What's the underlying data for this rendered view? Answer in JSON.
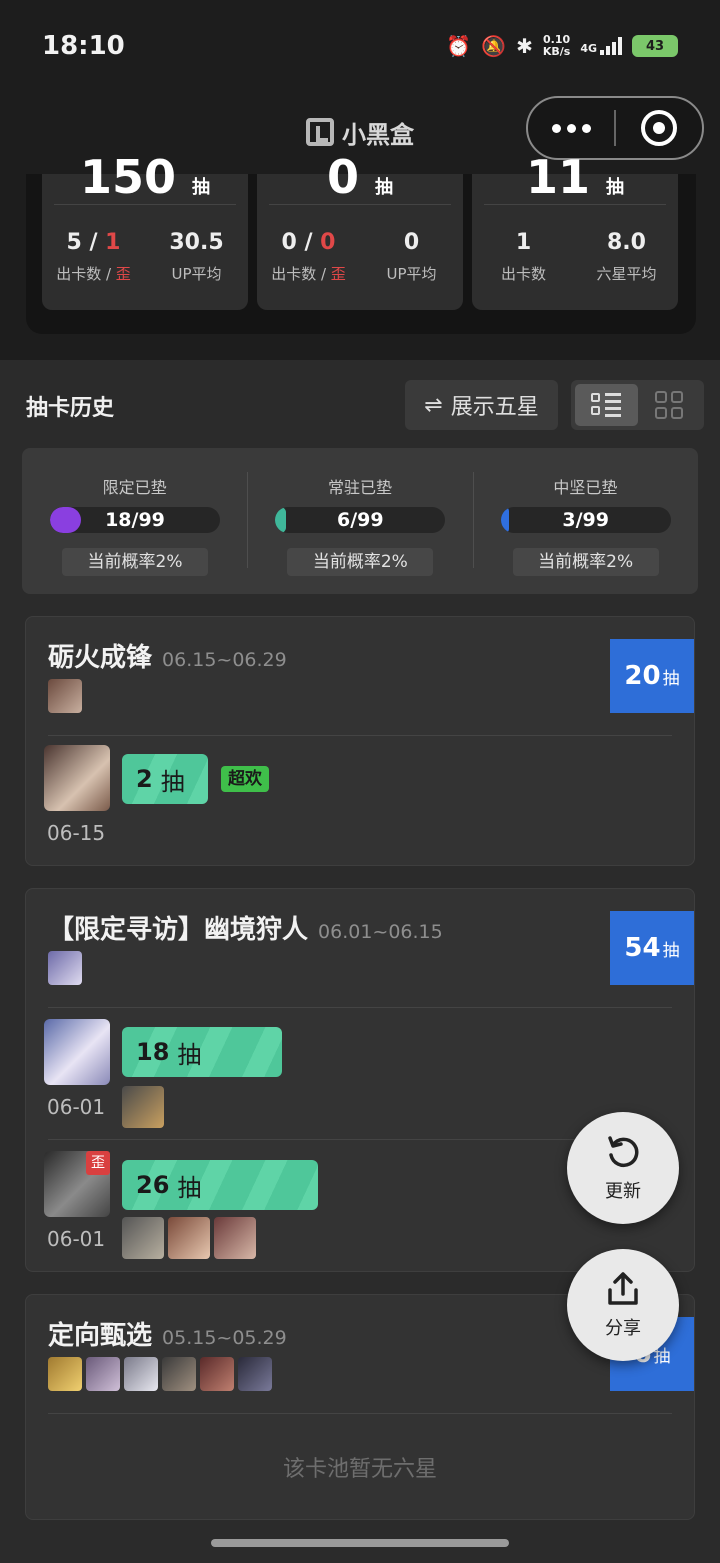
{
  "status_bar": {
    "time": "18:10",
    "net_speed_value": "0.10",
    "net_speed_unit": "KB/s",
    "network": "4G",
    "battery": "43"
  },
  "nav": {
    "title": "小黑盒",
    "more_icon": "more-dots-icon",
    "target_icon": "target-icon"
  },
  "stats": [
    {
      "big": "150",
      "big_unit": "抽",
      "left_value_a": "5",
      "left_sep": " / ",
      "left_value_b": "1",
      "left_label_a": "出卡数 / ",
      "left_label_b": "歪",
      "right_value": "30.5",
      "right_label": "UP平均"
    },
    {
      "big": "0",
      "big_unit": "抽",
      "left_value_a": "0",
      "left_sep": " / ",
      "left_value_b": "0",
      "left_label_a": "出卡数 / ",
      "left_label_b": "歪",
      "right_value": "0",
      "right_label": "UP平均"
    },
    {
      "big": "11",
      "big_unit": "抽",
      "left_value_a": "1",
      "left_sep": "",
      "left_value_b": "",
      "left_label_a": "出卡数",
      "left_label_b": "",
      "right_value": "8.0",
      "right_label": "六星平均"
    }
  ],
  "history": {
    "title": "抽卡历史",
    "filter_button": "展示五星",
    "filter_icon": "swap-arrows-icon",
    "view_list_icon": "list-view-icon",
    "view_grid_icon": "grid-view-icon"
  },
  "pity": [
    {
      "label": "限定已垫",
      "value": "18/99",
      "fraction": 0.18,
      "color": "#8a3fe0",
      "rate": "当前概率2%"
    },
    {
      "label": "常驻已垫",
      "value": "6/99",
      "fraction": 0.06,
      "color": "#3fb79a",
      "rate": "当前概率2%"
    },
    {
      "label": "中坚已垫",
      "value": "3/99",
      "fraction": 0.03,
      "color": "#2f6fe0",
      "rate": "当前概率2%"
    }
  ],
  "banners": [
    {
      "name": "砺火成锋",
      "dates": "06.15~06.29",
      "count": "20",
      "count_unit": "抽",
      "pulls": [
        {
          "date": "06-15",
          "count": "2",
          "unit": "抽",
          "badge": "超欢"
        }
      ]
    },
    {
      "name": "【限定寻访】幽境狩人",
      "dates": "06.01~06.15",
      "count": "54",
      "count_unit": "抽",
      "pulls": [
        {
          "date": "06-01",
          "count": "18",
          "unit": "抽"
        },
        {
          "date": "06-01",
          "count": "26",
          "unit": "抽",
          "off_badge": "歪"
        }
      ]
    },
    {
      "name": "定向甄选",
      "dates": "05.15~05.29",
      "count": "6",
      "count_unit": "抽",
      "empty_note": "该卡池暂无六星"
    }
  ],
  "fabs": {
    "refresh": "更新",
    "share": "分享"
  }
}
